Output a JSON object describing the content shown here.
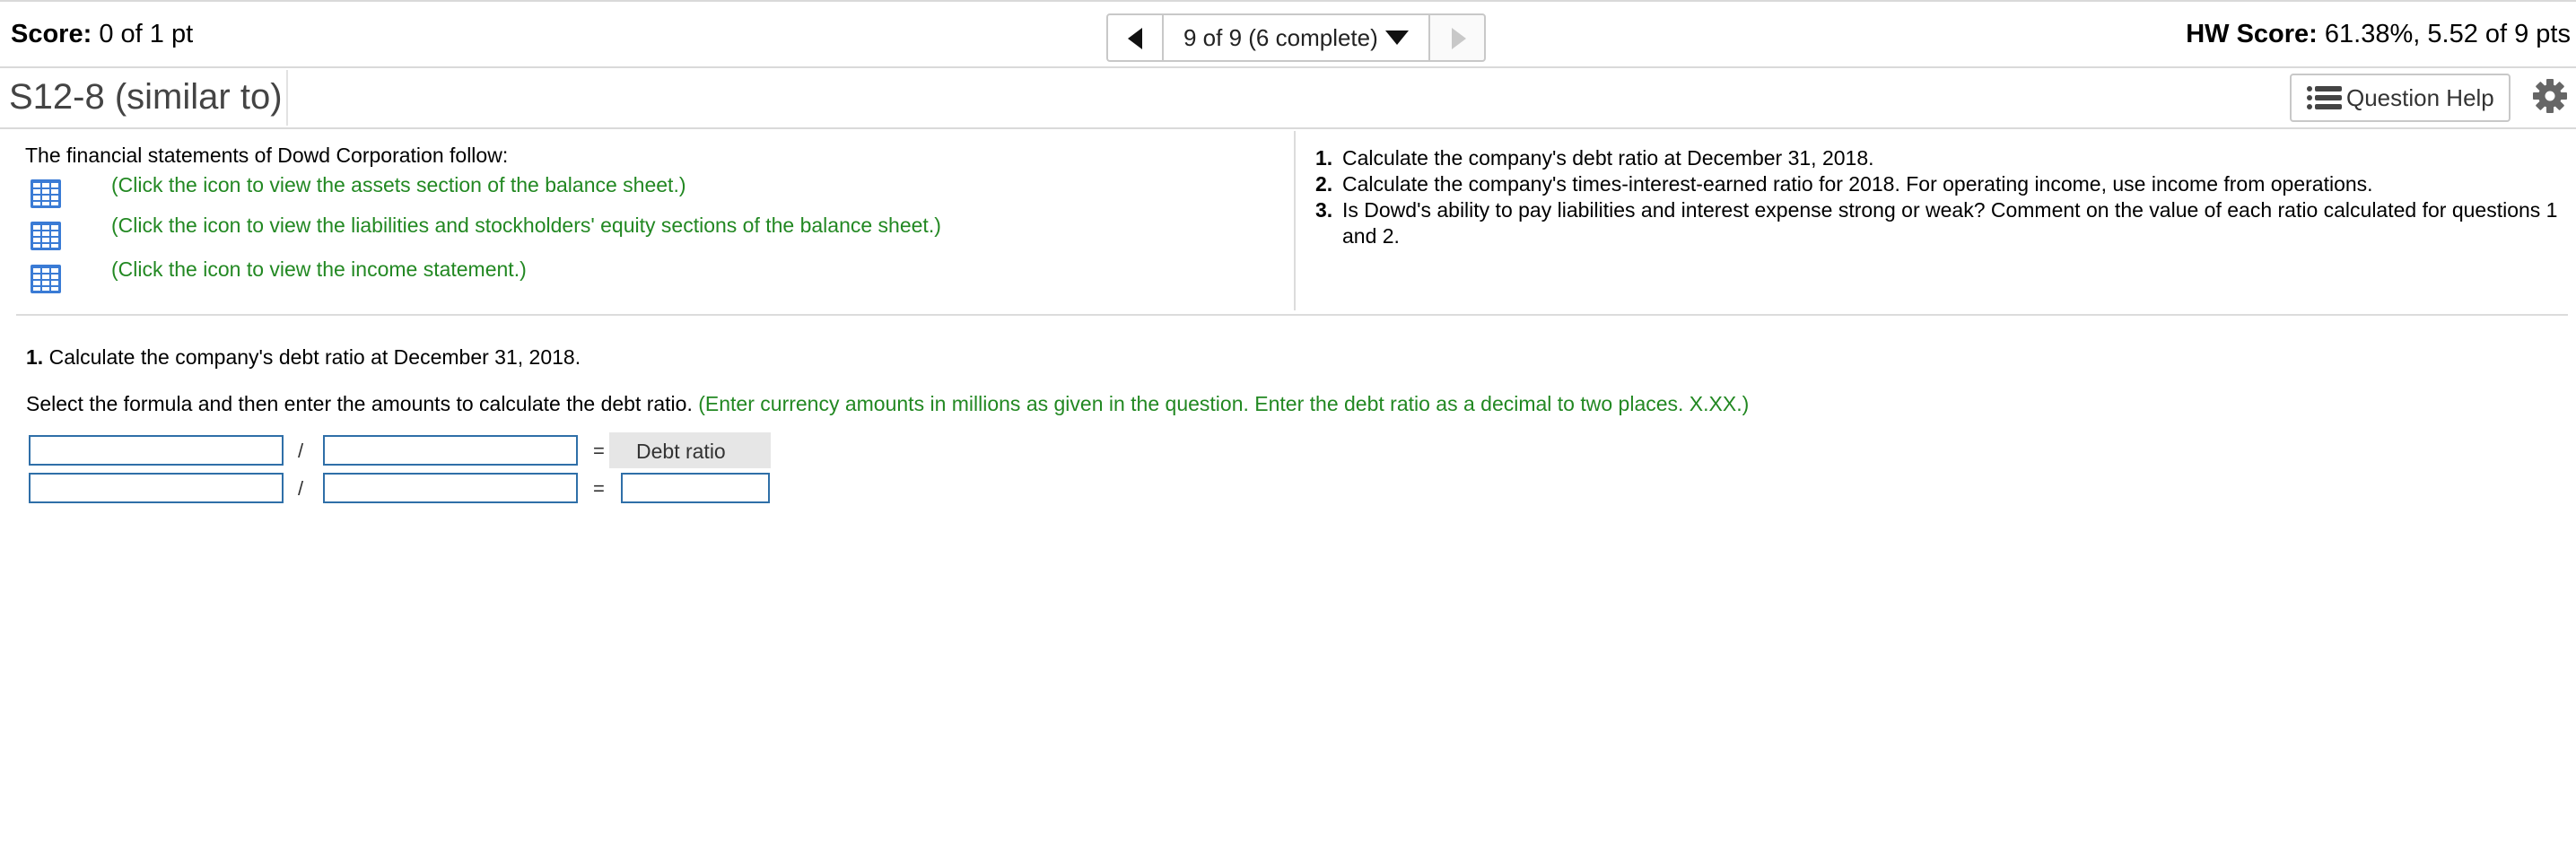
{
  "header": {
    "score_label": "Score:",
    "score_value": "0 of 1 pt",
    "hw_score_label": "HW Score:",
    "hw_score_value": "61.38%, 5.52 of 9 pts",
    "nav_status": "9 of 9 (6 complete)"
  },
  "question": {
    "title": "S12-8 (similar to)",
    "help_label": "Question Help"
  },
  "statements": {
    "intro": "The financial statements of Dowd Corporation follow:",
    "links": [
      "(Click the icon to view the assets section of the balance sheet.)",
      "(Click the icon to view the liabilities and stockholders' equity sections of the balance sheet.)",
      "(Click the icon to view the income statement.)"
    ]
  },
  "tasks": [
    {
      "num": "1.",
      "text": "Calculate the company's debt ratio at December 31, 2018."
    },
    {
      "num": "2.",
      "text": "Calculate the company's times-interest-earned ratio for 2018. For operating income, use income from operations."
    },
    {
      "num": "3.",
      "text": "Is Dowd's ability to pay liabilities and interest expense strong or weak? Comment on the value of each ratio calculated for questions 1 and 2."
    }
  ],
  "part1": {
    "num": "1.",
    "text": "Calculate the company's debt ratio at December 31, 2018.",
    "instruction": "Select the formula and then enter the amounts to calculate the debt ratio.",
    "hint": "(Enter currency amounts in millions as given in the question. Enter the debt ratio as a decimal to two places. X.XX.)"
  },
  "formula": {
    "divide": "/",
    "equals": "=",
    "result_label": "Debt ratio",
    "row1": {
      "numerator": "",
      "denominator": ""
    },
    "row2": {
      "numerator": "",
      "denominator": "",
      "result": ""
    }
  },
  "colors": {
    "link_green": "#228822",
    "input_border": "#2f6fa8",
    "icon_blue": "#3a7bd5"
  },
  "icons": [
    "prev-arrow-icon",
    "next-arrow-icon",
    "dropdown-caret-icon",
    "list-icon",
    "gear-icon",
    "table-grid-icon"
  ]
}
